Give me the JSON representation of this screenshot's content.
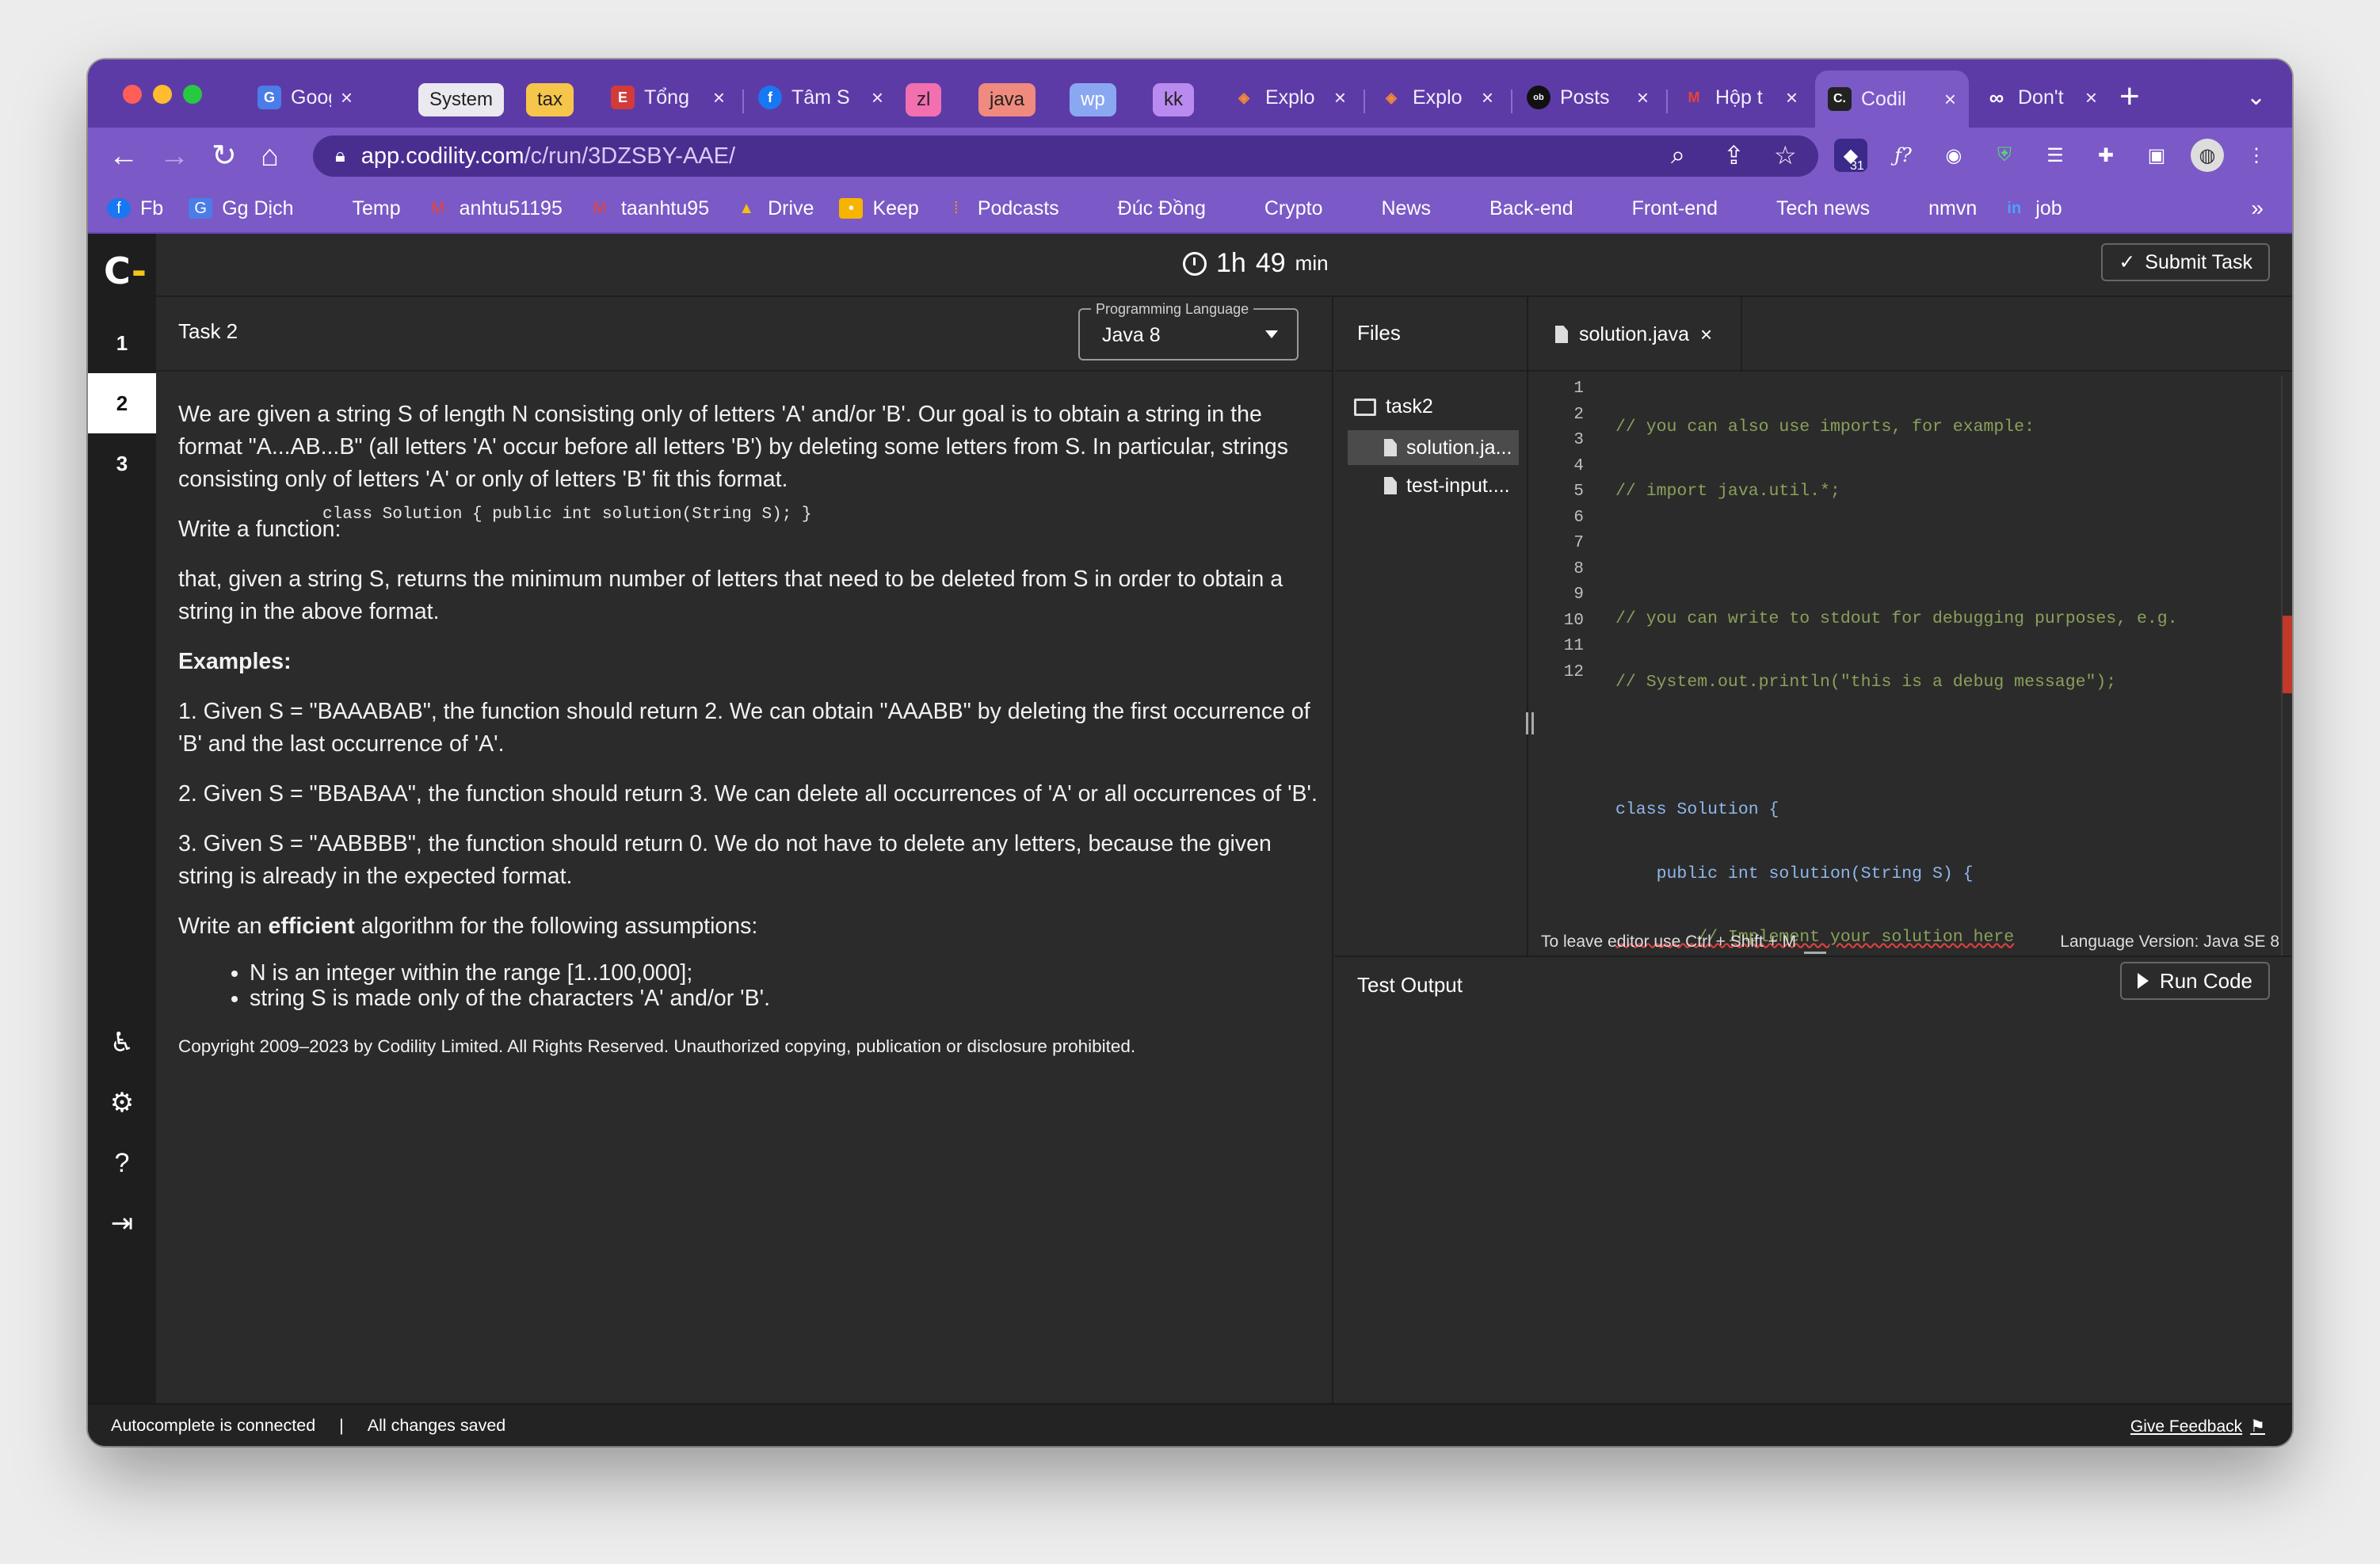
{
  "browser": {
    "tabs": [
      {
        "title": "Goog",
        "icon": "google-translate-icon"
      },
      {
        "title": "System",
        "chip": true
      },
      {
        "title": "tax",
        "chip": true
      },
      {
        "title": "Tổng",
        "icon": "doc-icon"
      },
      {
        "title": "Tâm S",
        "icon": "facebook-icon"
      },
      {
        "title": "zl",
        "chip": true
      },
      {
        "title": "java",
        "chip": true
      },
      {
        "title": "wp",
        "chip": true
      },
      {
        "title": "kk",
        "chip": true
      },
      {
        "title": "Explo",
        "icon": "explorer-icon"
      },
      {
        "title": "Explo",
        "icon": "explorer-icon"
      },
      {
        "title": "Posts",
        "icon": "obsidian-icon"
      },
      {
        "title": "Hộp t",
        "icon": "gmail-icon"
      },
      {
        "title": "Codil",
        "icon": "codility-icon",
        "active": true
      },
      {
        "title": "Don't",
        "icon": "infinity-icon"
      }
    ],
    "url_host": "app.codility.com",
    "url_path": "/c/run/3DZSBY-AAE/",
    "extension_badge": "31",
    "bookmarks": [
      "Fb",
      "Gg Dịch",
      "Temp",
      "anhtu51195",
      "taanhtu95",
      "Drive",
      "Keep",
      "Podcasts",
      "Đúc Đồng",
      "Crypto",
      "News",
      "Back-end",
      "Front-end",
      "Tech news",
      "nmvn",
      "job"
    ],
    "more": "»"
  },
  "app": {
    "logo": "C",
    "timer_hours": "1h",
    "timer_minutes": "49",
    "timer_unit": "min",
    "submit_label": "Submit Task",
    "rail_items": [
      "1",
      "2",
      "3"
    ],
    "task_title": "Task 2",
    "language_label": "Programming Language",
    "language_value": "Java 8",
    "description": {
      "p1": "We are given a string S of length N consisting only of letters 'A' and/or 'B'. Our goal is to obtain a string in the format \"A...AB...B\" (all letters 'A' occur before all letters 'B') by deleting some letters from S. In particular, strings consisting only of letters 'A' or only of letters 'B' fit this format.",
      "p2": "Write a function:",
      "signature": "class Solution { public int solution(String S); }",
      "p3": "that, given a string S, returns the minimum number of letters that need to be deleted from S in order to obtain a string in the above format.",
      "examples_label": "Examples:",
      "ex1": "1. Given S = \"BAAABAB\", the function should return 2. We can obtain \"AAABB\" by deleting the first occurrence of 'B' and the last occurrence of 'A'.",
      "ex2": "2. Given S = \"BBABAA\", the function should return 3. We can delete all occurrences of 'A' or all occurrences of 'B'.",
      "ex3": "3. Given S = \"AABBBB\", the function should return 0. We do not have to delete any letters, because the given string is already in the expected format.",
      "assump_pre": "Write an ",
      "assump_bold": "efficient",
      "assump_post": " algorithm for the following assumptions:",
      "bullet1": "N is an integer within the range [1..100,000];",
      "bullet2": "string S is made only of the characters 'A' and/or 'B'.",
      "copyright": "Copyright 2009–2023 by Codility Limited. All Rights Reserved. Unauthorized copying, publication or disclosure prohibited."
    },
    "files_label": "Files",
    "folder": "task2",
    "files": [
      "solution.ja...",
      "test-input...."
    ],
    "editor_tab": "solution.java",
    "code_lines": [
      "// you can also use imports, for example:",
      "// import java.util.*;",
      "",
      "// you can write to stdout for debugging purposes, e.g.",
      "// System.out.println(\"this is a debug message\");",
      "",
      "class Solution {",
      "    public int solution(String S) {",
      "        // Implement your solution here",
      "    }",
      "}",
      ""
    ],
    "line_numbers": [
      "1",
      "2",
      "3",
      "4",
      "5",
      "6",
      "7",
      "8",
      "9",
      "10",
      "11",
      "12"
    ],
    "editor_hint": "To leave editor use Ctrl + Shift + M",
    "language_version": "Language Version: Java SE 8",
    "test_output_label": "Test Output",
    "run_label": "Run Code",
    "status_autocomplete": "Autocomplete is connected",
    "status_sep": "|",
    "status_saved": "All changes saved",
    "feedback": "Give Feedback"
  },
  "colors": {
    "chrome_purple": "#7b59c6",
    "tab_strip": "#5d3ba6",
    "app_bg": "#2b2b2b",
    "accent_yellow": "#f5c518",
    "error_red": "#c0392b"
  }
}
